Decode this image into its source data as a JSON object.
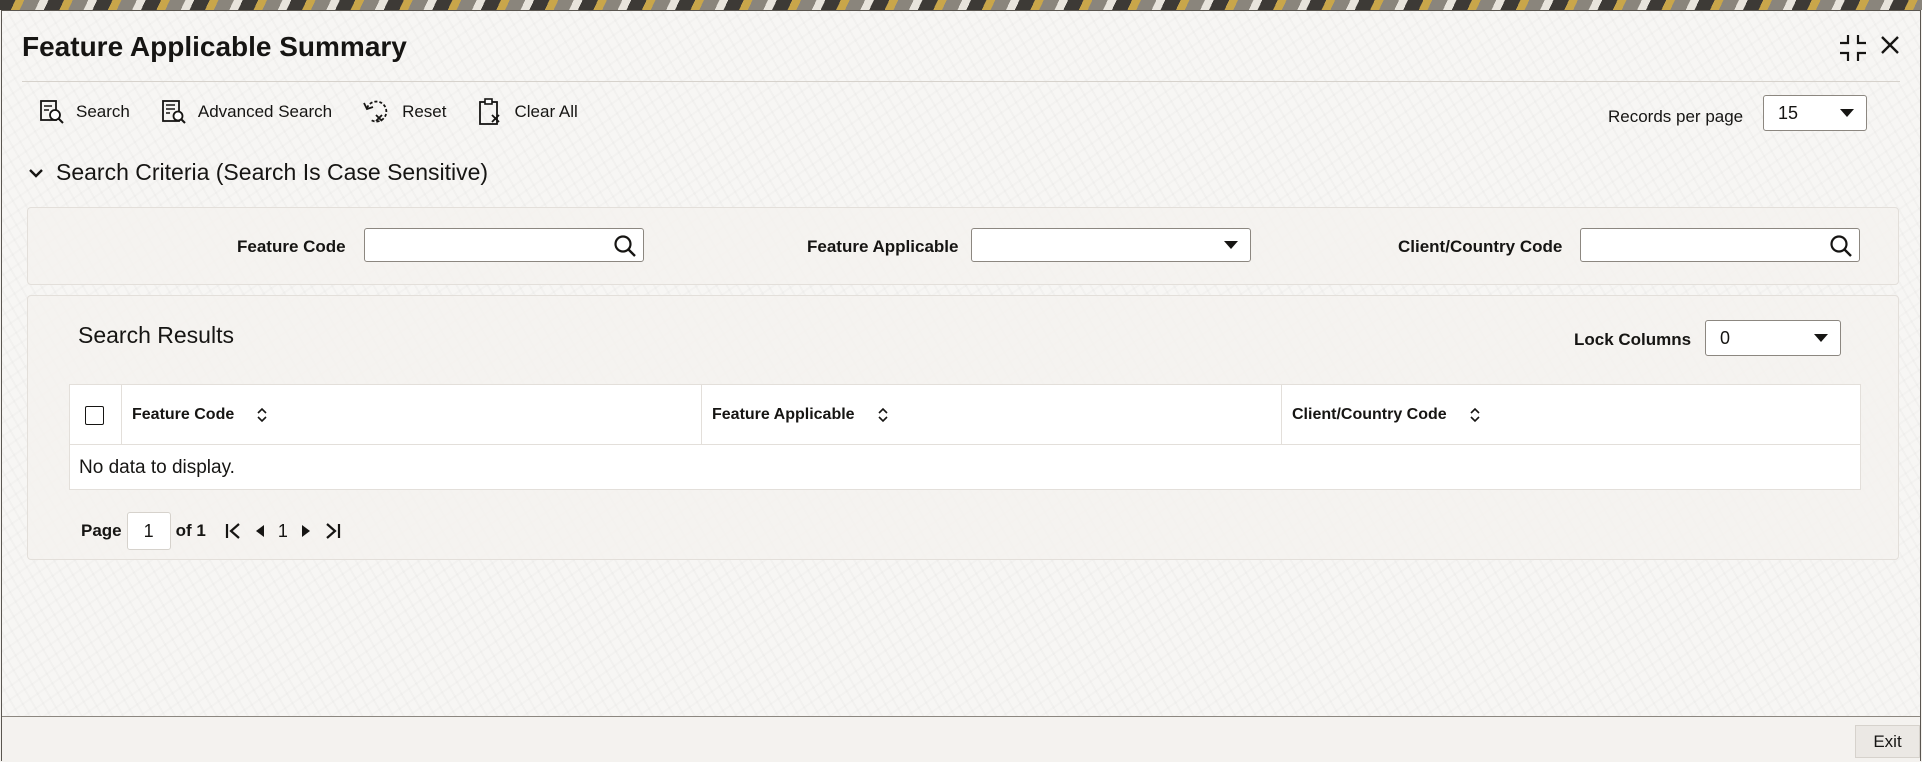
{
  "window": {
    "title": "Feature Applicable Summary"
  },
  "toolbar": {
    "search_label": "Search",
    "advanced_search_label": "Advanced Search",
    "reset_label": "Reset",
    "clear_all_label": "Clear All"
  },
  "records_per_page": {
    "label": "Records per page",
    "value": "15"
  },
  "criteria": {
    "heading": "Search Criteria (Search Is Case Sensitive)",
    "fields": {
      "feature_code_label": "Feature Code",
      "feature_code_value": "",
      "feature_applicable_label": "Feature Applicable",
      "feature_applicable_value": "",
      "client_country_label": "Client/Country Code",
      "client_country_value": ""
    }
  },
  "results": {
    "title": "Search Results",
    "lock_columns_label": "Lock Columns",
    "lock_columns_value": "0",
    "columns": [
      "Feature Code",
      "Feature Applicable",
      "Client/Country Code"
    ],
    "empty_text": "No data to display."
  },
  "pager": {
    "page_label": "Page",
    "page_value": "1",
    "of_label": "of 1",
    "current": "1"
  },
  "footer": {
    "exit_label": "Exit"
  },
  "icons": [
    "search-icon",
    "advanced-search-icon",
    "reset-icon",
    "clear-all-icon",
    "collapse-icon",
    "close-icon",
    "chevron-down-icon",
    "sort-icon",
    "first-page-icon",
    "prev-page-icon",
    "next-page-icon",
    "last-page-icon"
  ]
}
